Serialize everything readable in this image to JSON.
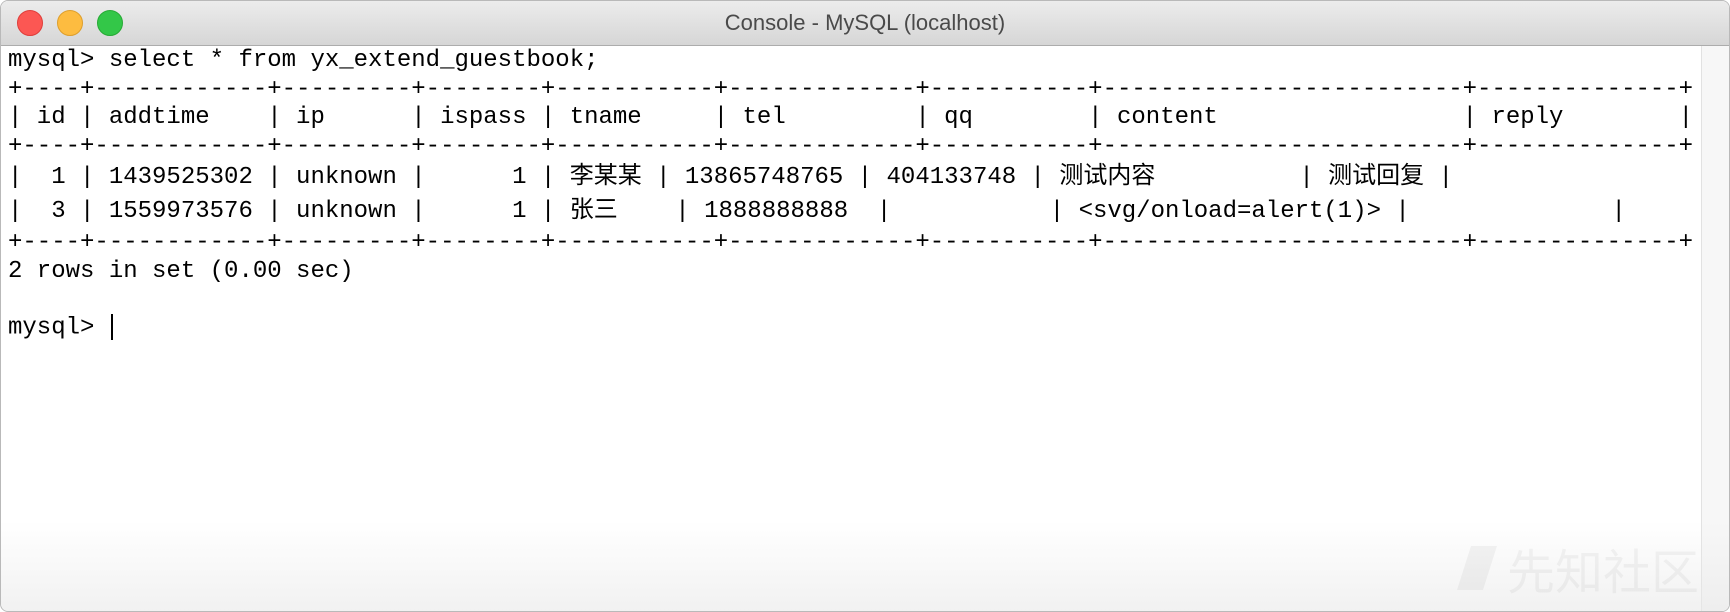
{
  "window": {
    "title": "Console - MySQL (localhost)",
    "controls": {
      "close": "#fc5753",
      "minimize": "#fdbc40",
      "maximize": "#33c748"
    }
  },
  "terminal": {
    "command": "mysql> select * from yx_extend_guestbook;",
    "border": "+----+------------+---------+--------+-----------+-------------+-----------+-------------------------+--------------+",
    "header": "| id | addtime    | ip      | ispass | tname     | tel         | qq        | content                 | reply        |",
    "columns": [
      "id",
      "addtime",
      "ip",
      "ispass",
      "tname",
      "tel",
      "qq",
      "content",
      "reply"
    ],
    "rows": [
      "|  1 | 1439525302 | unknown |      1 | 李某某 | 13865748765 | 404133748 | 测试内容          | 测试回复 |",
      "|  3 | 1559973576 | unknown |      1 | 张三    | 1888888888  |           | <svg/onload=alert(1)> |              |"
    ],
    "summary": "2 rows in set (0.00 sec)",
    "prompt": "mysql> "
  },
  "watermark": "先知社区"
}
